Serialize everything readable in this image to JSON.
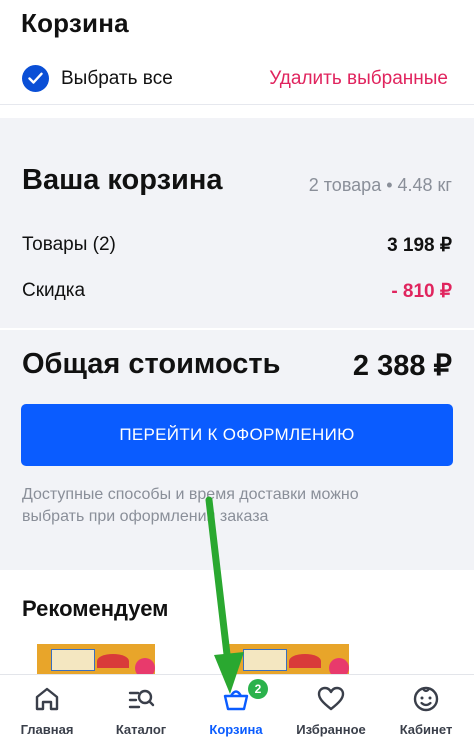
{
  "header": {
    "title": "Корзина"
  },
  "selection": {
    "select_all_label": "Выбрать все",
    "delete_selected_label": "Удалить выбранные"
  },
  "summary": {
    "title": "Ваша корзина",
    "meta": "2 товара • 4.48 кг",
    "items_label": "Товары (2)",
    "items_value": "3 198 ₽",
    "discount_label": "Скидка",
    "discount_value": "- 810 ₽",
    "total_label": "Общая стоимость",
    "total_value": "2 388 ₽",
    "checkout_label": "ПЕРЕЙТИ К ОФОРМЛЕНИЮ",
    "note": "Доступные способы и время доставки можно выбрать при оформлении заказа"
  },
  "recommend": {
    "title": "Рекомендуем"
  },
  "tabbar": {
    "tabs": [
      {
        "label": "Главная",
        "icon": "home-icon"
      },
      {
        "label": "Каталог",
        "icon": "catalog-search-icon"
      },
      {
        "label": "Корзина",
        "icon": "basket-icon",
        "badge": "2",
        "active": true
      },
      {
        "label": "Избранное",
        "icon": "heart-icon"
      },
      {
        "label": "Кабинет",
        "icon": "profile-face-icon"
      }
    ]
  },
  "colors": {
    "accent": "#0a5cff",
    "discount": "#e0245e",
    "badge": "#2bb24c",
    "annotation_arrow": "#2aa830"
  }
}
